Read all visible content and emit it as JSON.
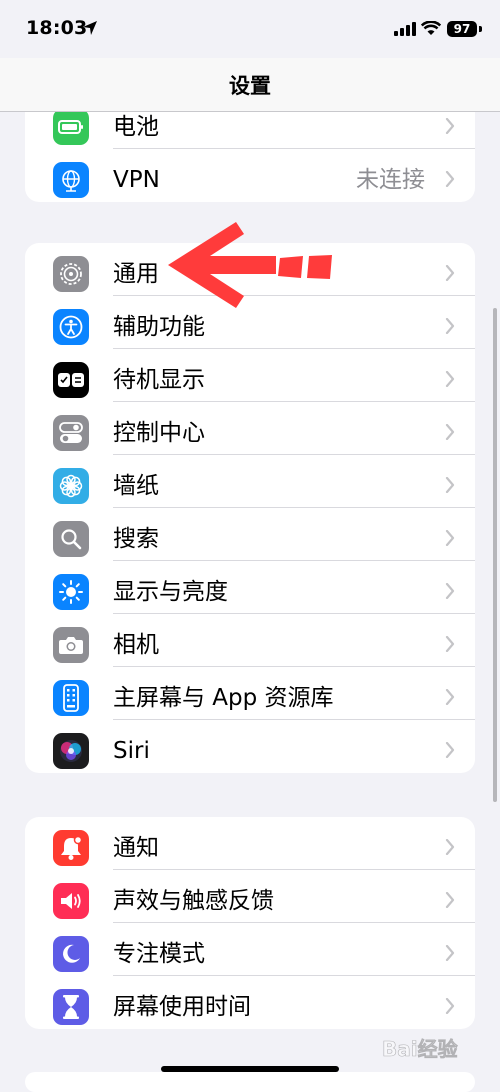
{
  "status": {
    "time": "18:03",
    "battery": "97"
  },
  "nav": {
    "title": "设置"
  },
  "group1": [
    {
      "label": "电池",
      "icon": "battery-icon",
      "color": "#34c759"
    },
    {
      "label": "VPN",
      "value": "未连接",
      "icon": "globe-icon",
      "color": "#0a84ff"
    }
  ],
  "group2": [
    {
      "label": "通用",
      "icon": "gear-icon",
      "color": "#8e8e93"
    },
    {
      "label": "辅助功能",
      "icon": "accessibility-icon",
      "color": "#0a84ff"
    },
    {
      "label": "待机显示",
      "icon": "standby-icon",
      "color": "#000000"
    },
    {
      "label": "控制中心",
      "icon": "toggles-icon",
      "color": "#8e8e93"
    },
    {
      "label": "墙纸",
      "icon": "flower-icon",
      "color": "#32ade6"
    },
    {
      "label": "搜索",
      "icon": "search-icon",
      "color": "#8e8e93"
    },
    {
      "label": "显示与亮度",
      "icon": "sun-icon",
      "color": "#0a84ff"
    },
    {
      "label": "相机",
      "icon": "camera-icon",
      "color": "#8e8e93"
    },
    {
      "label": "主屏幕与 App 资源库",
      "icon": "phone-grid-icon",
      "color": "#0a84ff"
    },
    {
      "label": "Siri",
      "icon": "siri-icon",
      "color": "#1c1c1e"
    }
  ],
  "group3": [
    {
      "label": "通知",
      "icon": "bell-icon",
      "color": "#ff3b30"
    },
    {
      "label": "声效与触感反馈",
      "icon": "speaker-icon",
      "color": "#ff2d55"
    },
    {
      "label": "专注模式",
      "icon": "moon-icon",
      "color": "#5e5ce6"
    },
    {
      "label": "屏幕使用时间",
      "icon": "hourglass-icon",
      "color": "#5e5ce6"
    }
  ],
  "watermark": {
    "text": "Bai经验"
  }
}
